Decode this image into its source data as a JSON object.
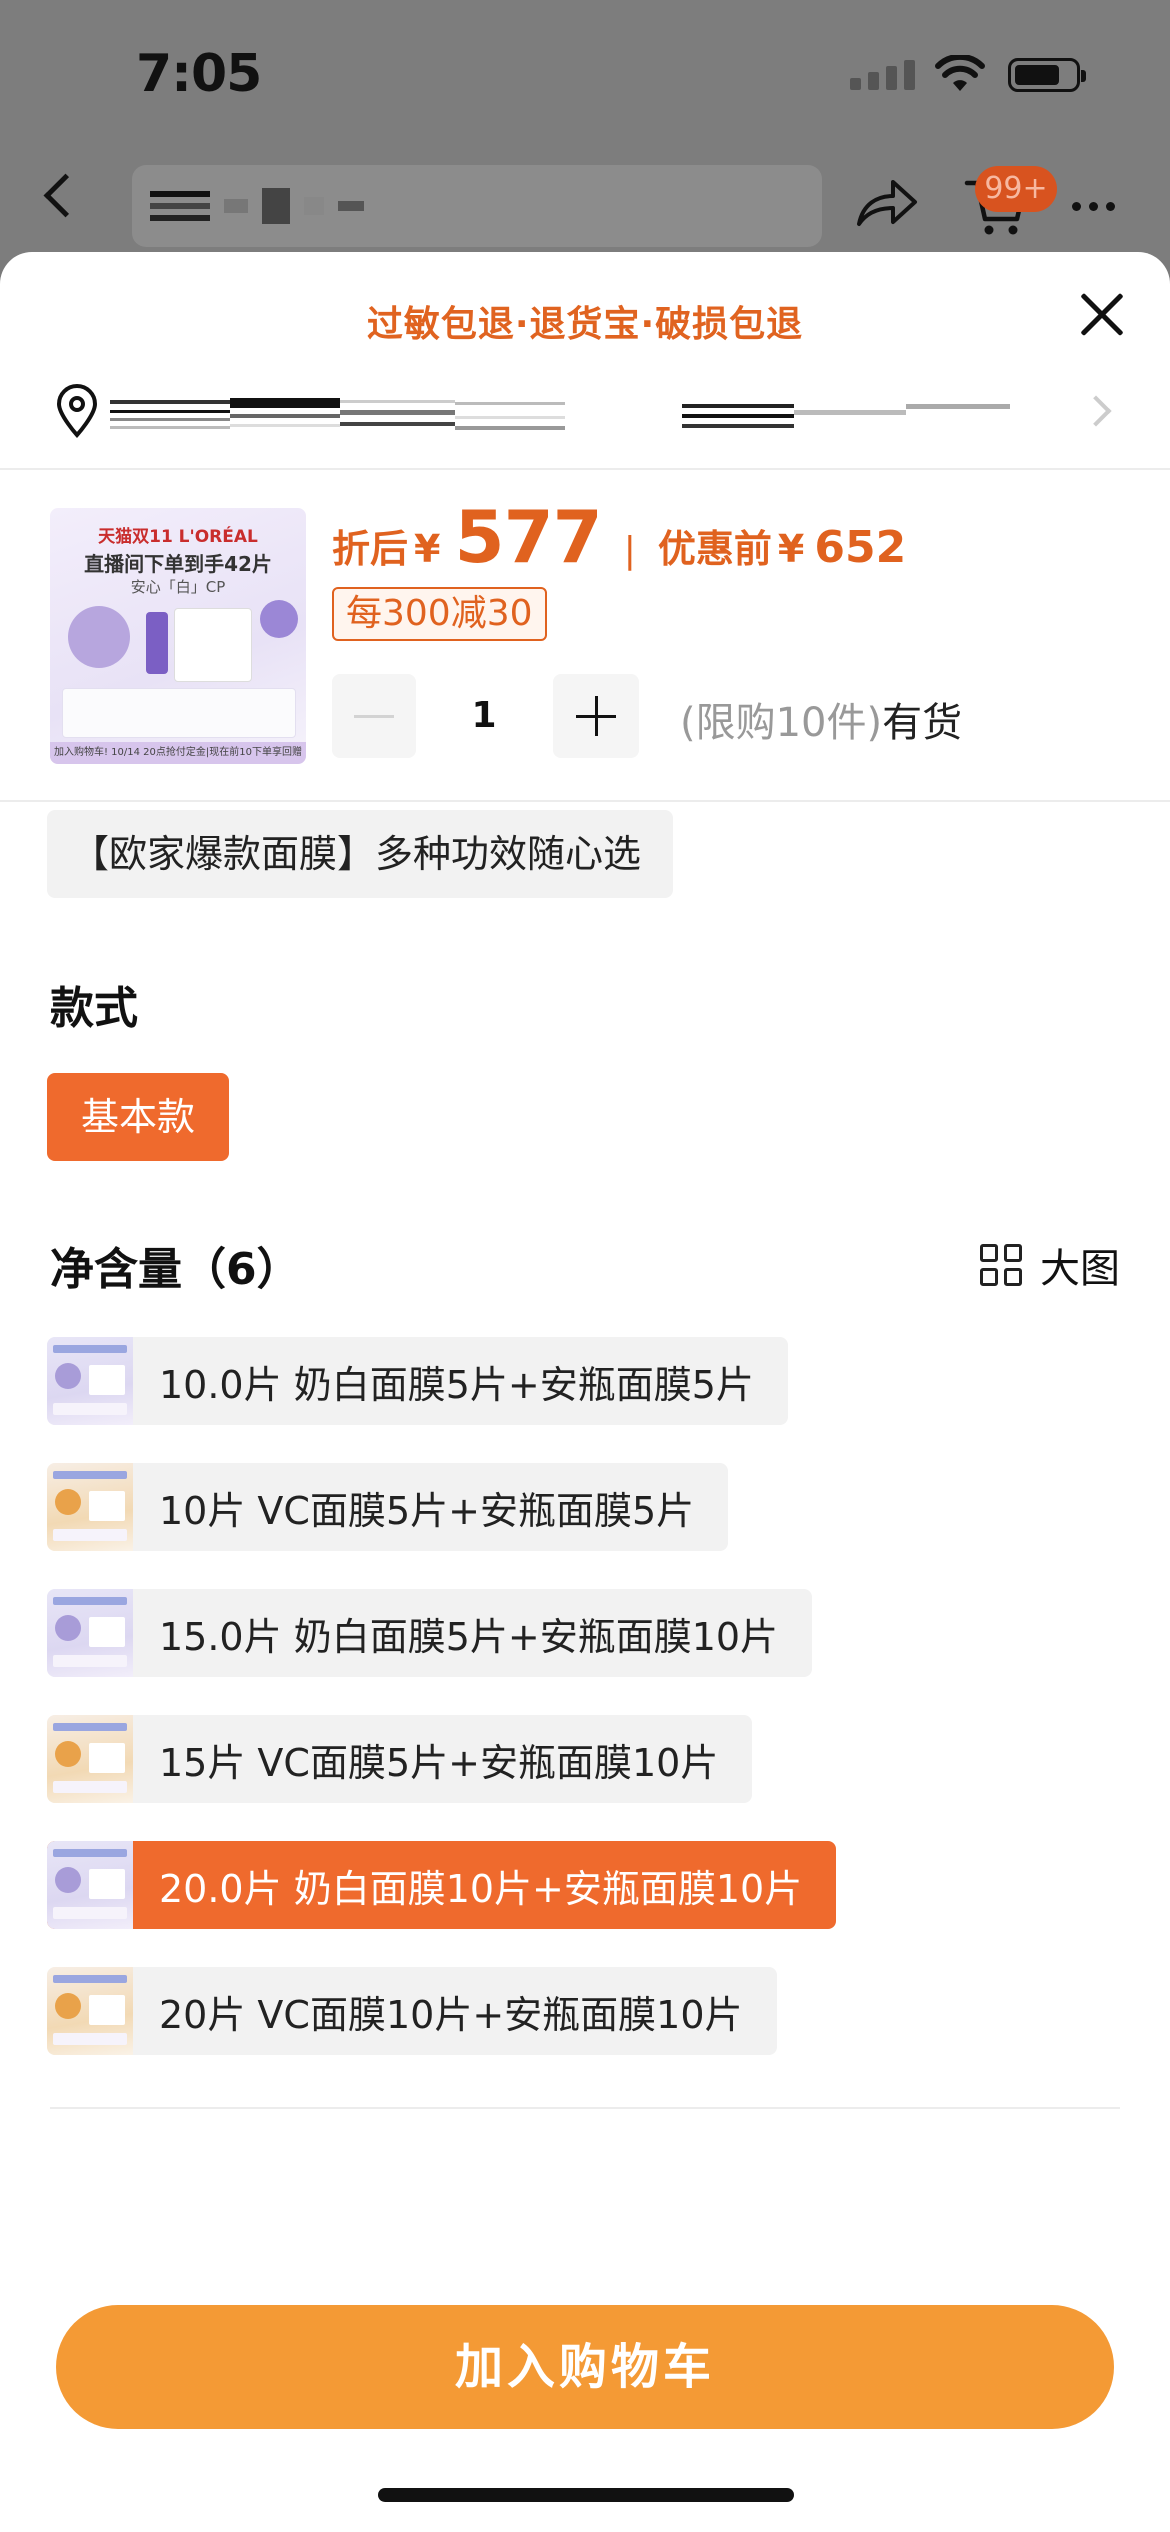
{
  "status_bar": {
    "time": "7:05"
  },
  "nav": {
    "cart_badge": "99+"
  },
  "sheet": {
    "guarantee_text": "过敏包退·退货宝·破损包退",
    "product": {
      "thumb_line1": "天猫双11 L'ORÉAL",
      "thumb_line2": "直播间下单到手42片",
      "thumb_line3": "安心「白」CP",
      "thumb_strip": "加入购物车! 10/14 20点抢付定金|现在前10下单享回赠",
      "price_label": "折后",
      "currency": "¥",
      "price_now": "577",
      "separator": "|",
      "price_before_label": "优惠前",
      "price_before": "652",
      "promo": "每300减30",
      "quantity": "1",
      "limit_text": "(限购10件)",
      "availability": "有货"
    },
    "bundle_option": "【欧家爆款面膜】多种功效随心选",
    "style_section": {
      "title": "款式",
      "selected": "基本款"
    },
    "size_section": {
      "title": "净含量（6）",
      "big_view_label": "大图",
      "options": [
        {
          "label": "10.0片 奶白面膜5片+安瓶面膜5片",
          "thumb": "white"
        },
        {
          "label": "10片 VC面膜5片+安瓶面膜5片",
          "thumb": "vc"
        },
        {
          "label": "15.0片 奶白面膜5片+安瓶面膜10片",
          "thumb": "white"
        },
        {
          "label": "15片 VC面膜5片+安瓶面膜10片",
          "thumb": "vc"
        },
        {
          "label": "20.0片 奶白面膜10片+安瓶面膜10片",
          "thumb": "white",
          "selected": true
        },
        {
          "label": "20片 VC面膜10片+安瓶面膜10片",
          "thumb": "vc"
        }
      ]
    },
    "add_to_cart": "加入购物车"
  },
  "colors": {
    "accent": "#ef6a2d",
    "cta": "#f49a35",
    "price": "#e0621f"
  }
}
